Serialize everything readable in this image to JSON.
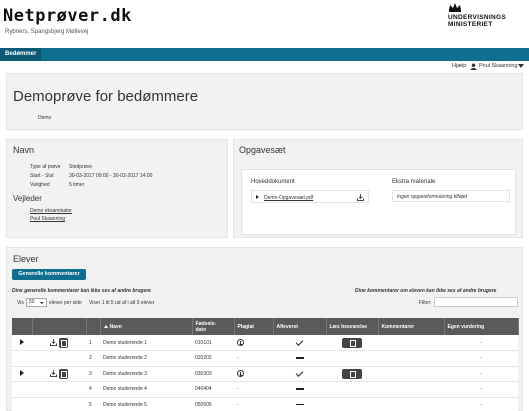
{
  "header": {
    "brand": "Netprøver.dk",
    "subtitle": "Rybners, Spangsbjerg Møllevej",
    "ministry_line1": "UNDERVISNINGS",
    "ministry_line2": "MINISTERIET"
  },
  "nav": {
    "tab": "Bedømmer"
  },
  "userbar": {
    "help": "Hjælp",
    "user": "Poul Skaanning"
  },
  "exam": {
    "title": "Demoprøve for bedømmere",
    "subtitle": "Demo"
  },
  "info": {
    "heading": "Navn",
    "rows": [
      {
        "label": "Type af prøve",
        "value": "Stedprøve"
      },
      {
        "label": "Start - Slut",
        "value": "30-03-2017 09:00 - 30-03-2017 14:00"
      },
      {
        "label": "Varighed",
        "value": "5 timer"
      }
    ],
    "vejleder_heading": "Vejleder",
    "vejledere": [
      "Demo eksaminator",
      "Poul Skaanning"
    ]
  },
  "opgavesaet": {
    "heading": "Opgavesæt",
    "hoveddokument_label": "Hoveddokument",
    "file": "Demo-Opgavesæt.pdf",
    "ekstra_label": "Ekstra materiale",
    "ekstra_value": "Ingen opgaveformulering tilføjet"
  },
  "elever": {
    "heading": "Elever",
    "general_btn": "Generelle kommentarer",
    "left_note": "Dine generelle kommentarer kan ikke ses af andre brugere",
    "right_note": "Dine kommentarer om eleven kan ikke ses af andre brugere",
    "show_label": "Vis",
    "per_page": "50",
    "per_page_suffix": "elever per side",
    "count_text": "Viser 1 til 5 ud af i alt 5 elever",
    "filter_label": "Filter:",
    "filter_value": ""
  },
  "table": {
    "headers": [
      "",
      "",
      "",
      "Navn",
      "Fødsels-\ndato",
      "Plagiat",
      "Afleveret",
      "Læs besvarelse",
      "Kommentarer",
      "Egen vurdering"
    ],
    "rows": [
      {
        "nr": "1",
        "name": "Demo studerende 1",
        "dob": "010101",
        "plagiat": "clock",
        "afleveret": "check",
        "read": true,
        "files": true,
        "vurdering": "-"
      },
      {
        "nr": "2",
        "name": "Demo studerende 2",
        "dob": "020202",
        "plagiat": "-",
        "afleveret": "dash",
        "read": false,
        "files": false,
        "vurdering": "-"
      },
      {
        "nr": "3",
        "name": "Demo studerende 3",
        "dob": "030303",
        "plagiat": "clock",
        "afleveret": "check",
        "read": true,
        "files": true,
        "vurdering": "-"
      },
      {
        "nr": "4",
        "name": "Demo studerende 4",
        "dob": "040404",
        "plagiat": "-",
        "afleveret": "dash",
        "read": false,
        "files": false,
        "vurdering": "-"
      },
      {
        "nr": "5",
        "name": "Demo studerende 5",
        "dob": "050505",
        "plagiat": "-",
        "afleveret": "dash",
        "read": false,
        "files": false,
        "vurdering": "-"
      }
    ]
  }
}
